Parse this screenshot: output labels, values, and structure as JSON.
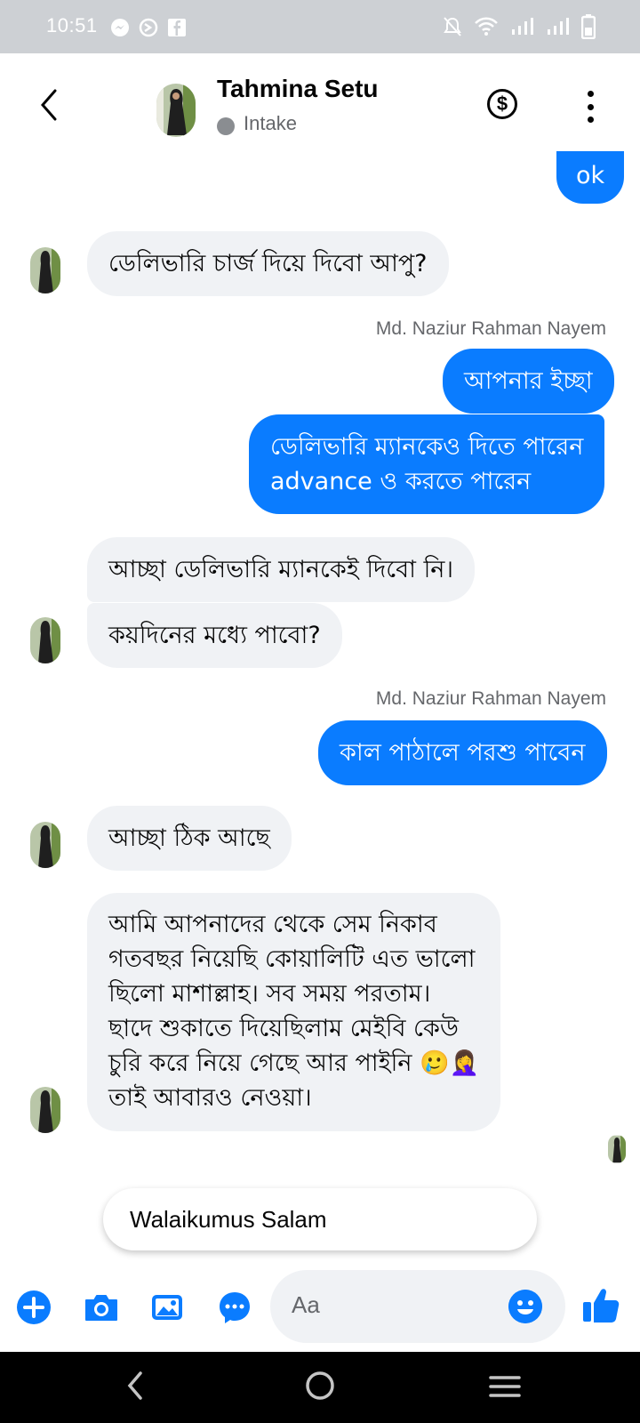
{
  "status_bar": {
    "time": "10:51",
    "left_icons": [
      "messenger-icon",
      "messenger-outline-icon",
      "facebook-icon"
    ],
    "right_icons": [
      "mute-icon",
      "wifi-icon",
      "signal-icon",
      "signal-icon",
      "battery-icon"
    ]
  },
  "header": {
    "contact_name": "Tahmina Setu",
    "contact_status": "Intake",
    "back_icon": "chevron-left-icon",
    "dollar_label": "$",
    "more_icon": "more-vertical-icon"
  },
  "messages": [
    {
      "type": "out",
      "text": "ok"
    },
    {
      "type": "in",
      "text": "ডেলিভারি চার্জ দিয়ে দিবো আপু?"
    },
    {
      "type": "sender",
      "text": "Md. Naziur Rahman Nayem"
    },
    {
      "type": "out",
      "text": "আপনার ইচ্ছা"
    },
    {
      "type": "out",
      "text": "ডেলিভারি ম্যানকেও দিতে পারেন\nadvance ও করতে পারেন"
    },
    {
      "type": "in",
      "text": "আচ্ছা ডেলিভারি ম্যানকেই দিবো নি।"
    },
    {
      "type": "in",
      "text": "কয়দিনের মধ্যে পাবো?"
    },
    {
      "type": "sender",
      "text": "Md. Naziur Rahman Nayem"
    },
    {
      "type": "out",
      "text": "কাল পাঠালে পরশু পাবেন"
    },
    {
      "type": "in",
      "text": "আচ্ছা ঠিক আছে"
    },
    {
      "type": "in",
      "text": "আমি আপনাদের থেকে সেম নিকাব\nগতবছর নিয়েছি কোয়ালিটি এত ভালো\nছিলো মাশাল্লাহ। সব সময় পরতাম।\nছাদে শুকাতে দিয়েছিলাম মেইবি কেউ\nচুরি করে নিয়ে গেছে আর পাইনি 🥲🤦‍♀️\nতাই আবারও নেওয়া।"
    }
  ],
  "suggestion": "Walaikumus Salam",
  "composer": {
    "placeholder": "Aa",
    "tools": [
      "plus-icon",
      "camera-icon",
      "gallery-icon",
      "chat-bubble-icon"
    ],
    "emoji_icon": "smiley-icon",
    "send_icon": "thumbs-up-icon"
  },
  "nav_bar": {
    "icons": [
      "back-icon",
      "home-icon",
      "recents-icon"
    ]
  },
  "colors": {
    "accent": "#0a7cff",
    "incoming_bubble": "#f0f2f5",
    "status_bar": "#cdd0d4",
    "secondary_text": "#65676b"
  }
}
